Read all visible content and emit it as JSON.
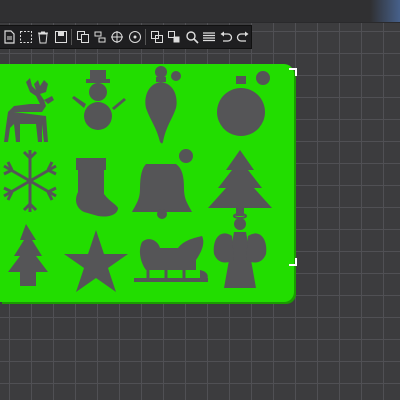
{
  "toolbar": {
    "tools": [
      {
        "name": "new-file-icon"
      },
      {
        "name": "select-region-icon"
      },
      {
        "name": "delete-icon"
      },
      {
        "name": "save-icon"
      },
      {
        "name": "copy-icon"
      },
      {
        "name": "align-icon"
      },
      {
        "name": "move-icon"
      },
      {
        "name": "center-icon"
      },
      {
        "name": "group-icon"
      },
      {
        "name": "ungroup-icon"
      },
      {
        "name": "zoom-icon"
      },
      {
        "name": "layers-icon"
      },
      {
        "name": "undo-icon"
      },
      {
        "name": "redo-icon"
      }
    ]
  },
  "stencil": {
    "color": "#22dd00",
    "cutout_color": "#555557",
    "shapes": [
      "reindeer",
      "snowman",
      "ornament-drop",
      "ornament-ball",
      "snowflake",
      "stocking",
      "bell",
      "christmas-tree",
      "decorated-tree",
      "star",
      "sleigh",
      "angel"
    ]
  },
  "colors": {
    "background": "#3c3c3e",
    "grid_line": "#505054",
    "toolbar": "#1e1e20"
  }
}
